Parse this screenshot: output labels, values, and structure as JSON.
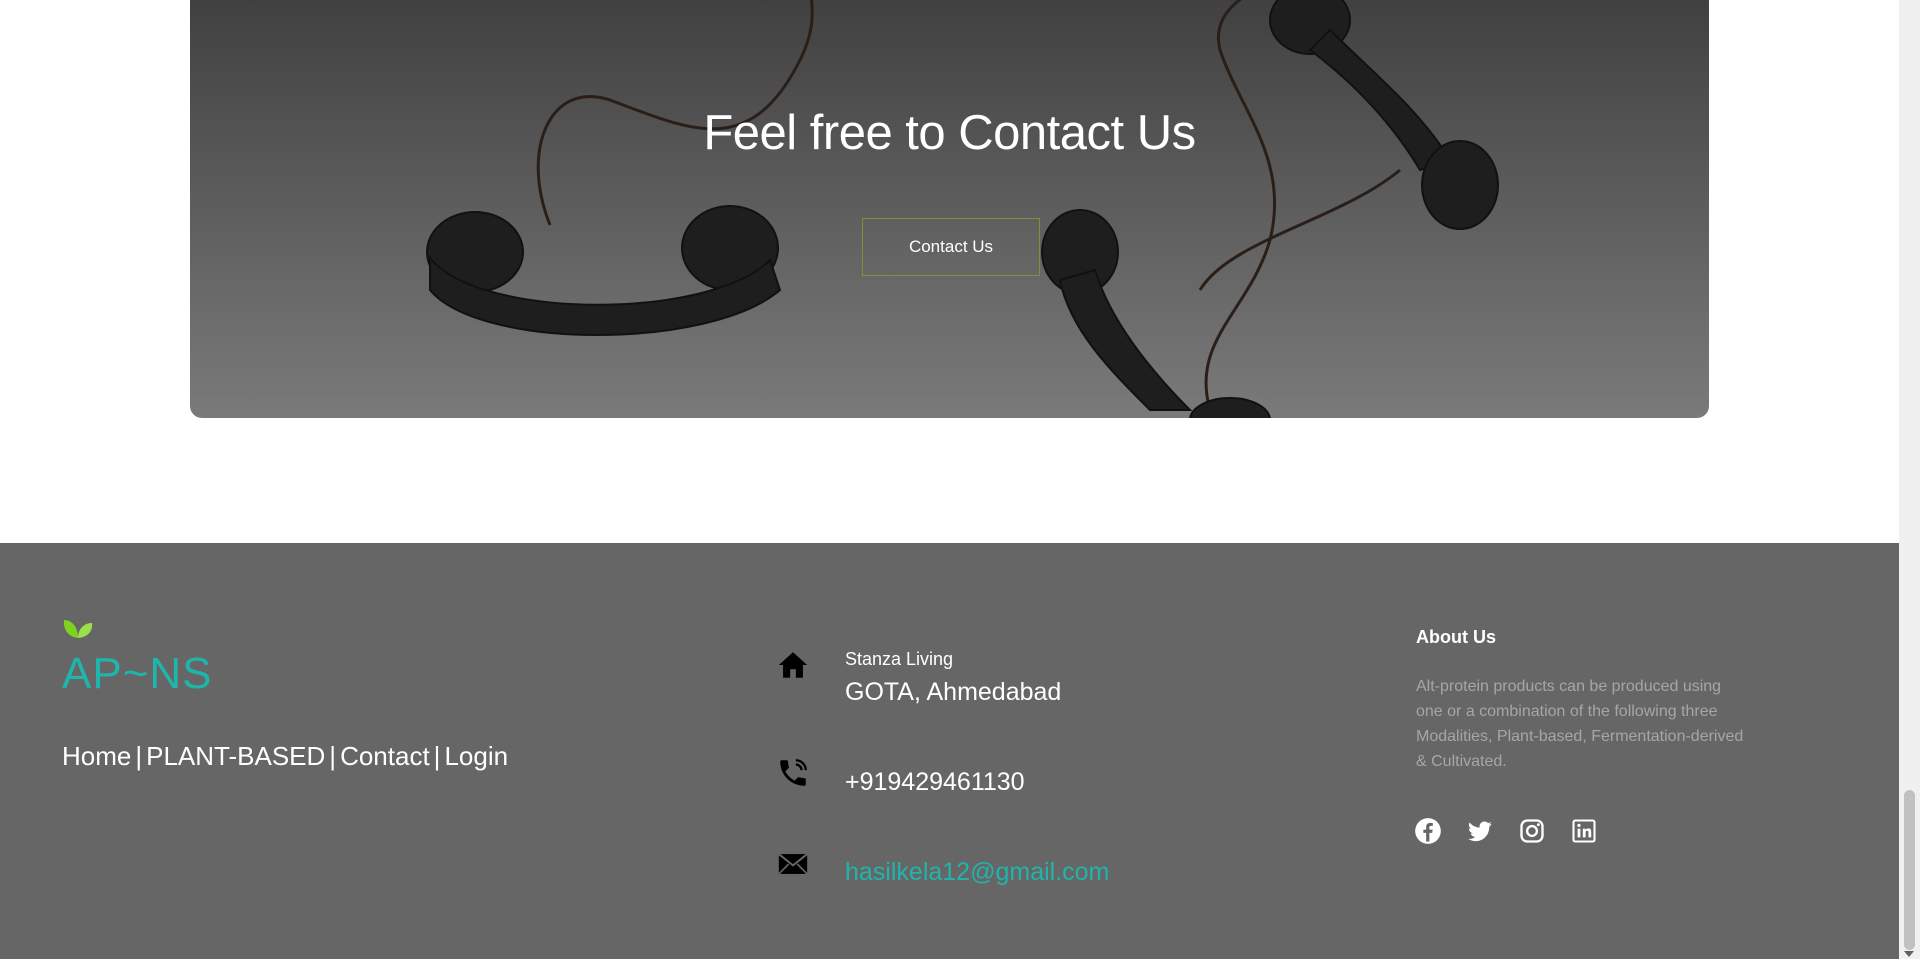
{
  "banner": {
    "title": "Feel free to Contact Us",
    "button_label": "Contact Us"
  },
  "footer": {
    "logo": "AP~NS",
    "nav": {
      "items": [
        "Home",
        "PLANT-BASED",
        "Contact",
        "Login"
      ],
      "separator": "|"
    },
    "address": {
      "line1": "Stanza Living",
      "line2": "GOTA, Ahmedabad",
      "icon": "home-icon"
    },
    "phone": {
      "number": "+919429461130",
      "icon": "phone-icon"
    },
    "email": {
      "address": "hasilkela12@gmail.com",
      "icon": "mail-icon"
    },
    "about": {
      "title": "About Us",
      "text": "Alt-protein products can be produced using one or a combination of the following three Modalities, Plant-based, Fermentation-derived & Cultivated."
    },
    "socials": [
      "facebook-icon",
      "twitter-icon",
      "instagram-icon",
      "linkedin-icon"
    ]
  },
  "colors": {
    "accent": "#1fb5ac",
    "footer_bg": "#666666",
    "leaf": "#7ed321"
  }
}
